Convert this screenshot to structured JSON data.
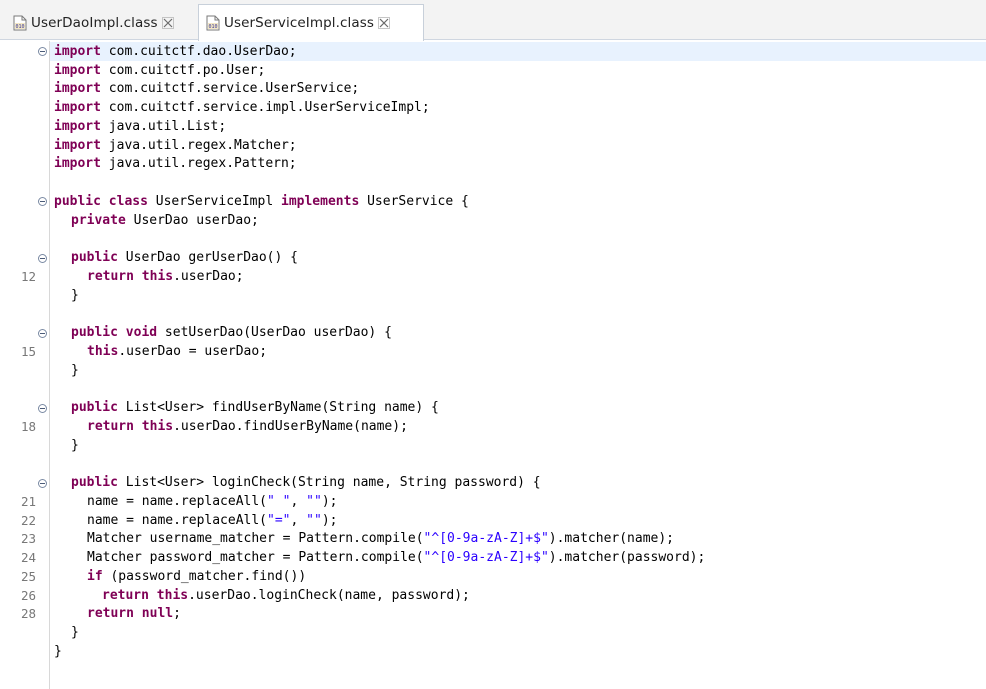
{
  "tabs": [
    {
      "label": "UserDaoImpl.class",
      "active": false
    },
    {
      "label": "UserServiceImpl.class",
      "active": true
    }
  ],
  "line_numbers": {
    "l12": "12",
    "l15": "15",
    "l18": "18",
    "l21": "21",
    "l22": "22",
    "l23": "23",
    "l24": "24",
    "l25": "25",
    "l26": "26",
    "l28": "28"
  },
  "code": {
    "kw_import": "import",
    "kw_public": "public",
    "kw_class": "class",
    "kw_implements": "implements",
    "kw_private": "private",
    "kw_return": "return",
    "kw_this": "this",
    "kw_void": "void",
    "kw_if": "if",
    "kw_null": "null",
    "i1": " com.cuitctf.dao.UserDao;",
    "i2": " com.cuitctf.po.User;",
    "i3": " com.cuitctf.service.UserService;",
    "i4": " com.cuitctf.service.impl.UserServiceImpl;",
    "i5": " java.util.List;",
    "i6": " java.util.regex.Matcher;",
    "i7": " java.util.regex.Pattern;",
    "class_name": " UserServiceImpl ",
    "class_iface": " UserService {",
    "field": " UserDao userDao;",
    "m1_sig": " UserDao gerUserDao() {",
    "m1_body": ".userDao;",
    "brace": "}",
    "m2_sig": " setUserDao(UserDao userDao) {",
    "m2_body": ".userDao = userDao;",
    "m3_sig": " List<User> findUserByName(String name) {",
    "m3_body": ".userDao.findUserByName(name);",
    "m4_sig": " List<User> loginCheck(String name, String password) {",
    "l21_a": "name = name.replaceAll(",
    "l21_s1": "\" \"",
    "l21_b": ", ",
    "l21_s2": "\"\"",
    "l21_c": ");",
    "l22_a": "name = name.replaceAll(",
    "l22_s1": "\"=\"",
    "l22_b": ", ",
    "l22_s2": "\"\"",
    "l22_c": ");",
    "l23_a": "Matcher username_matcher = Pattern.compile(",
    "l23_s": "\"^[0-9a-zA-Z]+$\"",
    "l23_b": ").matcher(name);",
    "l24_a": "Matcher password_matcher = Pattern.compile(",
    "l24_s": "\"^[0-9a-zA-Z]+$\"",
    "l24_b": ").matcher(password);",
    "l25": " (password_matcher.find())",
    "l26": ".userDao.loginCheck(name, password);",
    "l27": ";"
  },
  "colors": {
    "keyword": "#7f0055",
    "string": "#2a00ff",
    "current_line": "#e8f2fe"
  },
  "icons": [
    "class-file-icon",
    "close-icon",
    "fold-collapse-icon"
  ]
}
